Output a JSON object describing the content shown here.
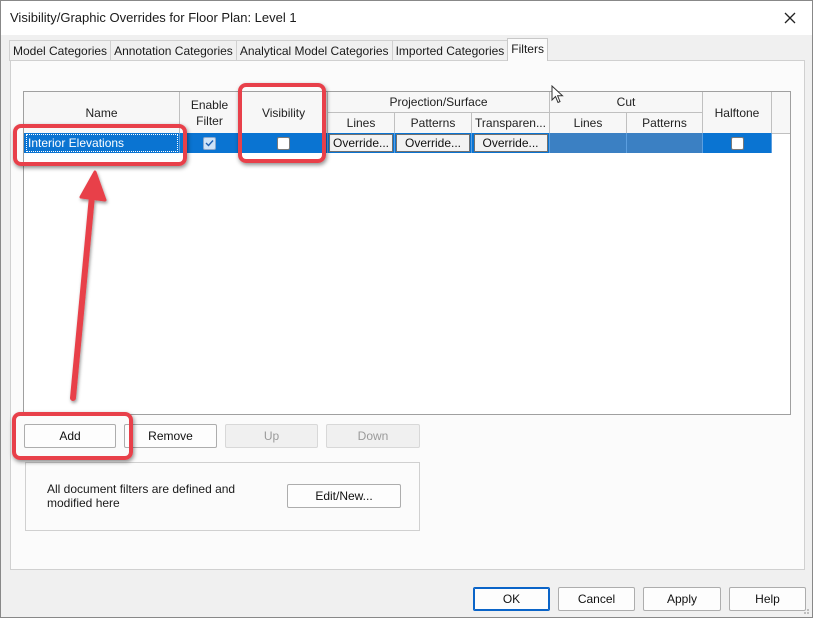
{
  "window": {
    "title": "Visibility/Graphic Overrides for Floor Plan: Level 1",
    "close_icon": "close-icon"
  },
  "tabs": [
    {
      "label": "Model Categories",
      "active": false
    },
    {
      "label": "Annotation Categories",
      "active": false
    },
    {
      "label": "Analytical Model Categories",
      "active": false
    },
    {
      "label": "Imported Categories",
      "active": false
    },
    {
      "label": "Filters",
      "active": true
    }
  ],
  "grid": {
    "headers": {
      "name": "Name",
      "enable_filter": "Enable Filter",
      "visibility": "Visibility",
      "projection_surface": "Projection/Surface",
      "proj_lines": "Lines",
      "proj_patterns": "Patterns",
      "proj_transparency": "Transparen...",
      "cut": "Cut",
      "cut_lines": "Lines",
      "cut_patterns": "Patterns",
      "halftone": "Halftone"
    },
    "rows": [
      {
        "name": "Interior Elevations",
        "enable_filter": true,
        "visibility": false,
        "proj_lines": "Override...",
        "proj_patterns": "Override...",
        "proj_transparency": "Override...",
        "halftone": false,
        "selected": true
      }
    ]
  },
  "actions": {
    "add": "Add",
    "remove": "Remove",
    "up": "Up",
    "down": "Down"
  },
  "info": {
    "description": "All document filters are defined and modified here",
    "edit_new": "Edit/New..."
  },
  "footer": {
    "ok": "OK",
    "cancel": "Cancel",
    "apply": "Apply",
    "help": "Help"
  },
  "colors": {
    "selection": "#0a74d2",
    "annotation": "#e8404a"
  }
}
